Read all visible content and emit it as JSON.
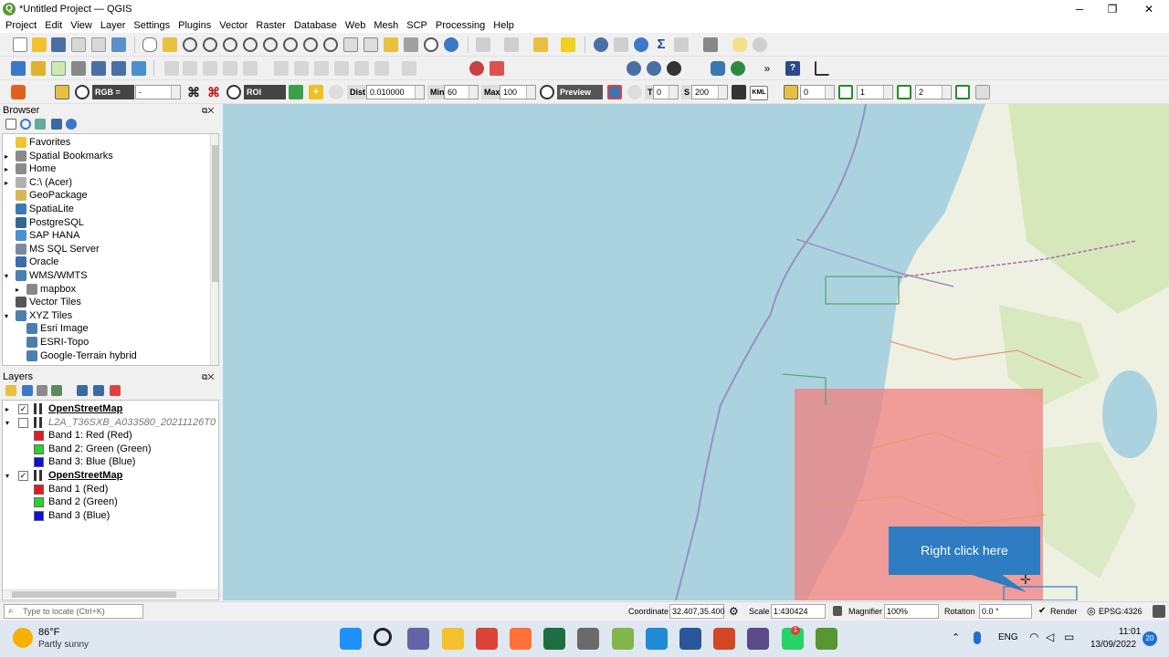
{
  "window": {
    "title": "*Untitled Project — QGIS",
    "app_icon": "qgis-logo-icon"
  },
  "menu": [
    "Project",
    "Edit",
    "View",
    "Layer",
    "Settings",
    "Plugins",
    "Vector",
    "Raster",
    "Database",
    "Web",
    "Mesh",
    "SCP",
    "Processing",
    "Help"
  ],
  "scp_toolbar": {
    "rgb_label": "RGB =",
    "rgb_value": "-",
    "roi_label": "ROI",
    "dist_label": "Dist",
    "dist_value": "0.010000",
    "min_label": "Min",
    "min_value": "60",
    "max_label": "Max",
    "max_value": "100",
    "preview_label": "Preview",
    "t_label": "T",
    "t_value": "0",
    "s_label": "S",
    "s_value": "200",
    "kml_label": "KML",
    "band_value_1": "0",
    "band_value_2": "1",
    "band_value_3": "2"
  },
  "browser": {
    "title": "Browser",
    "items": [
      {
        "label": "Favorites",
        "icon": "star-icon",
        "color": "#f2c230"
      },
      {
        "label": "Spatial Bookmarks",
        "icon": "bookmark-icon",
        "color": "#8a8a8a"
      },
      {
        "label": "Home",
        "icon": "home-icon",
        "color": "#8a8a8a"
      },
      {
        "label": "C:\\ (Acer)",
        "icon": "drive-icon",
        "color": "#b0b0b0"
      },
      {
        "label": "GeoPackage",
        "icon": "geopackage-icon",
        "color": "#d6b656"
      },
      {
        "label": "SpatiaLite",
        "icon": "spatialite-icon",
        "color": "#3c78b4"
      },
      {
        "label": "PostgreSQL",
        "icon": "postgresql-icon",
        "color": "#336791"
      },
      {
        "label": "SAP HANA",
        "icon": "sap-hana-icon",
        "color": "#4a8fd0"
      },
      {
        "label": "MS SQL Server",
        "icon": "mssql-icon",
        "color": "#7a8aa0"
      },
      {
        "label": "Oracle",
        "icon": "oracle-icon",
        "color": "#3a6ea5"
      },
      {
        "label": "WMS/WMTS",
        "icon": "globe-icon",
        "color": "#4a7fb0"
      },
      {
        "label": "mapbox",
        "icon": "wms-layer-icon",
        "color": "#888888"
      },
      {
        "label": "Vector Tiles",
        "icon": "vector-tiles-icon",
        "color": "#555555"
      },
      {
        "label": "XYZ Tiles",
        "icon": "xyz-tiles-icon",
        "color": "#4a7fb0"
      },
      {
        "label": "Esri Image",
        "icon": "tile-icon",
        "color": "#4a7fb0"
      },
      {
        "label": "ESRI-Topo",
        "icon": "tile-icon",
        "color": "#4a7fb0"
      },
      {
        "label": "Google-Terrain hybrid",
        "icon": "tile-icon",
        "color": "#4a7fb0"
      }
    ]
  },
  "layers": {
    "title": "Layers",
    "items": [
      {
        "label": "OpenStreetMap",
        "checked": true,
        "bold": true
      },
      {
        "label": "L2A_T36SXB_A033580_20211126T0",
        "checked": false,
        "italic": true
      },
      {
        "label": "Band 1: Red (Red)",
        "color": "#e8191d"
      },
      {
        "label": "Band 2: Green (Green)",
        "color": "#2dd12d"
      },
      {
        "label": "Band 3: Blue (Blue)",
        "color": "#1010d8"
      },
      {
        "label": "OpenStreetMap",
        "checked": true,
        "bold": true
      },
      {
        "label": "Band 1 (Red)",
        "color": "#e8191d"
      },
      {
        "label": "Band 2 (Green)",
        "color": "#2dd12d"
      },
      {
        "label": "Band 3 (Blue)",
        "color": "#1010d8"
      }
    ]
  },
  "map": {
    "callout_text": "Right click here",
    "callout_color": "#2e7cc2",
    "sea_color": "#aad3df",
    "land_color": "#eef0e2",
    "overlay_color": "#f08080"
  },
  "status": {
    "locate_placeholder": "Type to locate (Ctrl+K)",
    "coordinate_label": "Coordinate",
    "coordinate_value": "32.407,35.400",
    "scale_label": "Scale",
    "scale_value": "1:430424",
    "magnifier_label": "Magnifier",
    "magnifier_value": "100%",
    "rotation_label": "Rotation",
    "rotation_value": "0.0 °",
    "render_label": "Render",
    "crs": "EPSG:4326"
  },
  "taskbar": {
    "weather_temp": "86°F",
    "weather_desc": "Partly sunny",
    "lang": "ENG",
    "time": "11:01",
    "date": "13/09/2022",
    "notif_count": "20",
    "whatsapp_badge": "1",
    "apps": [
      {
        "name": "start-icon",
        "color": "#1e90ff"
      },
      {
        "name": "search-icon",
        "color": "#222222"
      },
      {
        "name": "teams-icon",
        "color": "#6264a7"
      },
      {
        "name": "file-explorer-icon",
        "color": "#f3c030"
      },
      {
        "name": "chrome-icon",
        "color": "#db4437"
      },
      {
        "name": "firefox-icon",
        "color": "#ff7139"
      },
      {
        "name": "excel-icon",
        "color": "#1d6f42"
      },
      {
        "name": "snipping-tool-icon",
        "color": "#6a6a6a"
      },
      {
        "name": "notepad-plus-icon",
        "color": "#82b74b"
      },
      {
        "name": "vpn-icon",
        "color": "#1f8ad6"
      },
      {
        "name": "word-icon",
        "color": "#2b579a"
      },
      {
        "name": "powerpoint-icon",
        "color": "#d24726"
      },
      {
        "name": "obs-icon",
        "color": "#5a4a8a"
      },
      {
        "name": "whatsapp-icon",
        "color": "#25d366"
      },
      {
        "name": "qgis-icon",
        "color": "#589632"
      }
    ]
  }
}
